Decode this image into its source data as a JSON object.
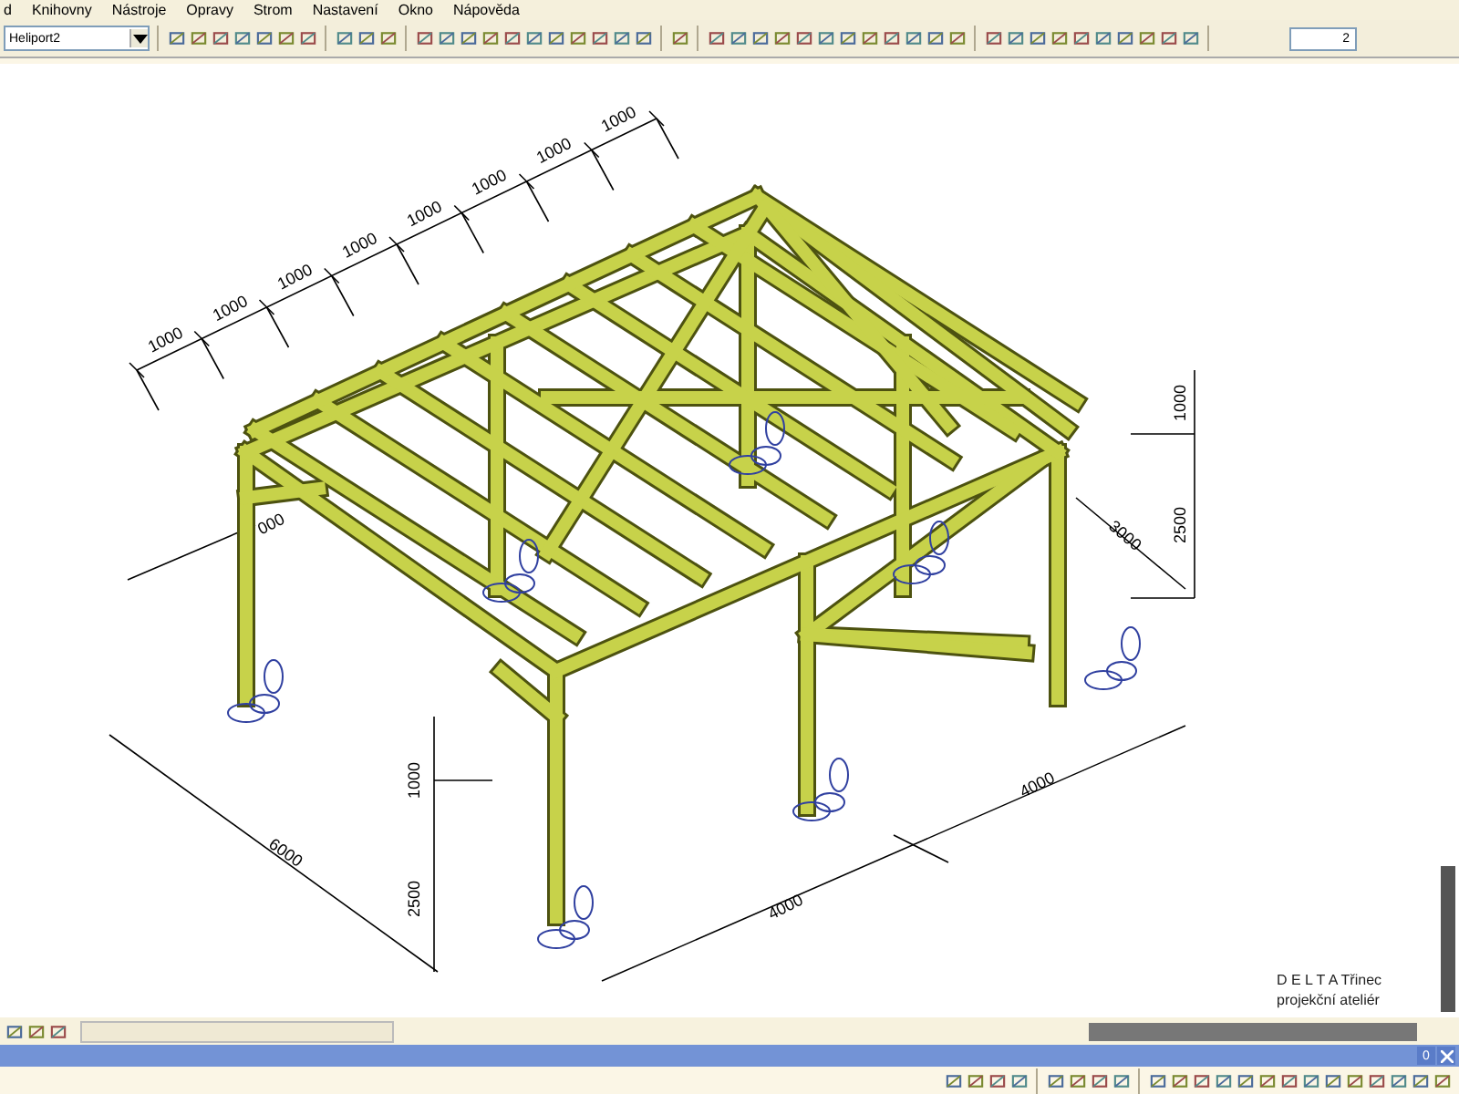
{
  "menu": [
    "d",
    "Knihovny",
    "Nástroje",
    "Opravy",
    "Strom",
    "Nastavení",
    "Okno",
    "Nápověda"
  ],
  "toolbar": {
    "model_combo": {
      "value": "Heliport2"
    },
    "spin_field": {
      "value": "2"
    }
  },
  "drawing": {
    "top_dimensions": [
      "1000",
      "1000",
      "1000",
      "1000",
      "1000",
      "1000",
      "1000",
      "1000"
    ],
    "other_dimensions": [
      "000",
      "1000",
      "2500",
      "3000",
      "1000",
      "2500",
      "6000",
      "4000",
      "4000"
    ],
    "title_block": [
      "D E L T A Třinec",
      "projekční ateliér"
    ]
  },
  "dock_bar": {
    "button": "0"
  }
}
